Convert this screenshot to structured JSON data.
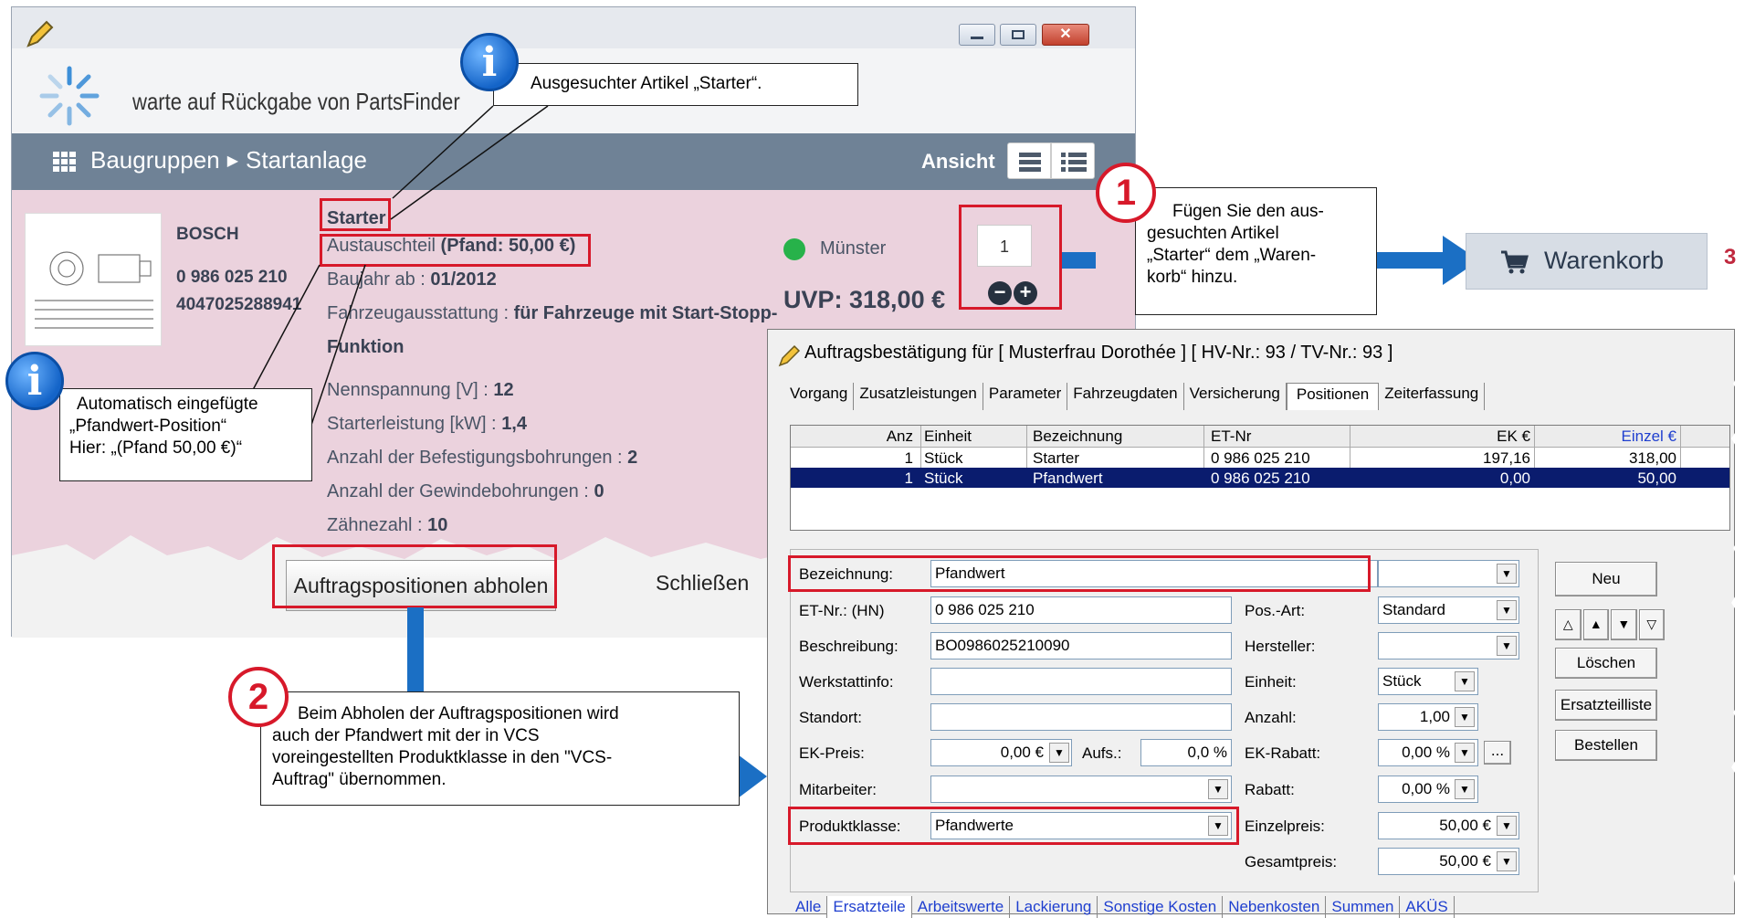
{
  "partsfinder": {
    "status_text": "warte auf Rückgabe von PartsFinder",
    "breadcrumb_root": "Baugruppen",
    "breadcrumb_sep": "▶",
    "breadcrumb_current": "Startanlage",
    "view_label": "Ansicht",
    "product": {
      "brand": "BOSCH",
      "part_number": "0 986 025 210",
      "ean": "4047025288941",
      "name": "Starter",
      "exchange_prefix": "Austauschteil",
      "exchange_deposit": "(Pfand: 50,00 €)",
      "year_label": "Baujahr ab :",
      "year_value": "01/2012",
      "equip_label": "Fahrzeugausstattung :",
      "equip_value": "für Fahrzeuge mit Start-Stopp-",
      "equip_value2": "Funktion",
      "specs": [
        {
          "label": "Nennspannung [V] :",
          "value": "12"
        },
        {
          "label": "Starterleistung [kW] :",
          "value": "1,4"
        },
        {
          "label": "Anzahl der Befestigungsbohrungen :",
          "value": "2"
        },
        {
          "label": "Anzahl der Gewindebohrungen :",
          "value": "0"
        },
        {
          "label": "Zähnezahl :",
          "value": "10"
        }
      ],
      "availability_location": "Münster",
      "price": "UVP: 318,00 €",
      "quantity": "1"
    },
    "fetch_button": "Auftragspositionen abholen",
    "close_button": "Schließen"
  },
  "cart": {
    "label": "Warenkorb",
    "count": "3"
  },
  "callouts": {
    "info1": "Ausgesuchter Artikel „Starter“.",
    "info2_line1": "Automatisch eingefügte",
    "info2_line2": "„Pfandwert-Position“",
    "info2_line3": "Hier: „(Pfand 50,00 €)“",
    "step1_num": "1",
    "step1_line1": "Fügen Sie den aus-",
    "step1_line2": "gesuchten Artikel",
    "step1_line3": "„Starter“ dem „Waren-",
    "step1_line4": "korb“ hinzu.",
    "step2_num": "2",
    "step2_line1": "Beim Abholen der Auftragspositionen wird",
    "step2_line2": "auch der Pfandwert mit der in VCS",
    "step2_line3": "voreingestellten Produktklasse in den \"VCS-",
    "step2_line4": "Auftrag\" übernommen.",
    "info_glyph": "i"
  },
  "vcs": {
    "title": "Auftragsbestätigung  für [ Musterfrau Dorothée ]  [ HV-Nr.: 93 / TV-Nr.: 93 ]",
    "tabs": [
      "Vorgang",
      "Zusatzleistungen",
      "Parameter",
      "Fahrzeugdaten",
      "Versicherung",
      "Positionen",
      "Zeiterfassung"
    ],
    "table_headers": [
      "Anz",
      "Einheit",
      "Bezeichnung",
      "ET-Nr",
      "EK €",
      "Einzel €"
    ],
    "rows": [
      [
        "1",
        "Stück",
        "Starter",
        "0 986 025 210",
        "197,16",
        "318,00"
      ],
      [
        "1",
        "Stück",
        "Pfandwert",
        "0 986 025 210",
        "0,00",
        "50,00"
      ]
    ],
    "form": {
      "bezeichnung_label": "Bezeichnung:",
      "bezeichnung_value": "Pfandwert",
      "etnr_label": "ET-Nr.: (HN)",
      "etnr_value": "0 986 025 210",
      "beschreibung_label": "Beschreibung:",
      "beschreibung_value": "BO0986025210090",
      "werkstattinfo_label": "Werkstattinfo:",
      "standort_label": "Standort:",
      "ekpreis_label": "EK-Preis:",
      "ekpreis_value": "0,00 €",
      "aufs_label": "Aufs.:",
      "aufs_value": "0,0 %",
      "mitarbeiter_label": "Mitarbeiter:",
      "produktklasse_label": "Produktklasse:",
      "produktklasse_value": "Pfandwerte",
      "posart_label": "Pos.-Art:",
      "posart_value": "Standard",
      "hersteller_label": "Hersteller:",
      "einheit_label": "Einheit:",
      "einheit_value": "Stück",
      "anzahl_label": "Anzahl:",
      "anzahl_value": "1,00",
      "ekrabatt_label": "EK-Rabatt:",
      "ekrabatt_value": "0,00 %",
      "rabatt_label": "Rabatt:",
      "rabatt_value": "0,00 %",
      "einzelpreis_label": "Einzelpreis:",
      "einzelpreis_value": "50,00 €",
      "gesamtpreis_label": "Gesamtpreis:",
      "gesamtpreis_value": "50,00 €",
      "ellipsis": "..."
    },
    "buttons": {
      "neu": "Neu",
      "loeschen": "Löschen",
      "ersatzteilliste": "Ersatzteilliste",
      "bestellen": "Bestellen"
    },
    "bottom_tabs": [
      "Alle",
      "Ersatzteile",
      "Arbeitswerte",
      "Lackierung",
      "Sonstige Kosten",
      "Nebenkosten",
      "Summen",
      "AKÜS"
    ]
  },
  "colors": {
    "highlight": "#d7192a",
    "arrow": "#1b6fc4",
    "selected_row": "#0a1c6e"
  }
}
